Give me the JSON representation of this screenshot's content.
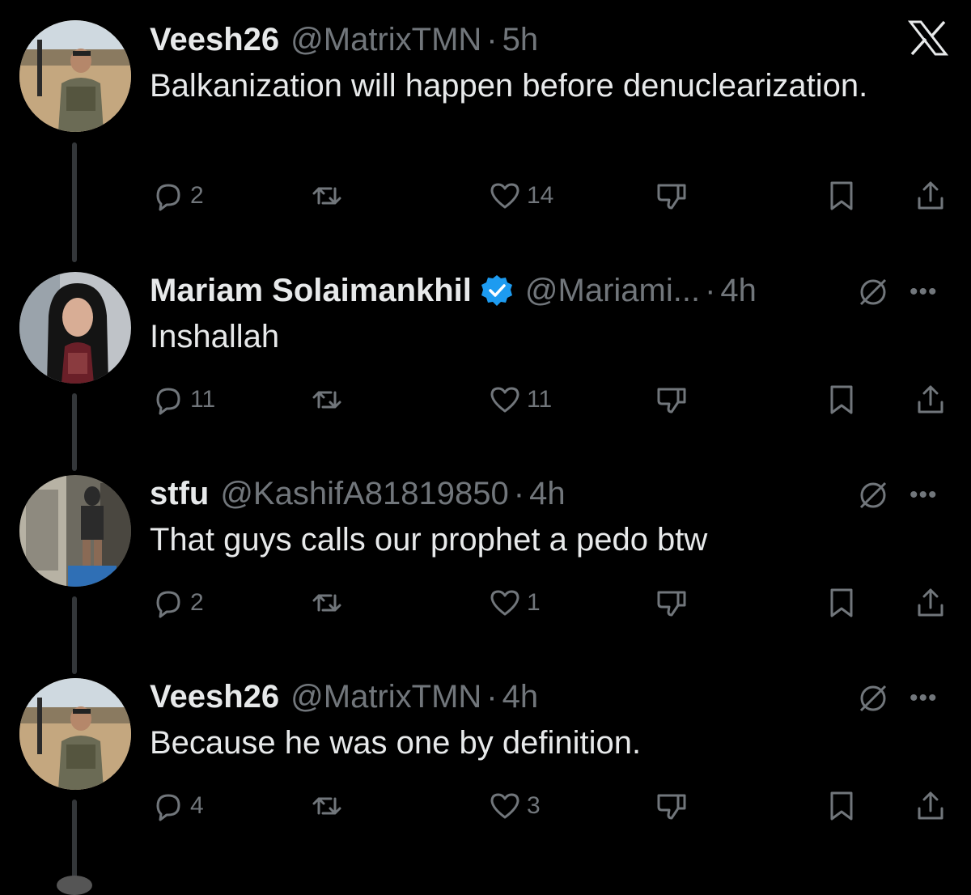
{
  "tweets": [
    {
      "name": "Veesh26",
      "handle": "@MatrixTMN",
      "dot": "·",
      "time": "5h",
      "text": "Balkanization will happen before denuclearization.",
      "replies": "2",
      "likes": "14"
    },
    {
      "name": "Mariam Solaimankhil",
      "handle": "@Mariami...",
      "dot": "·",
      "time": "4h",
      "text": "Inshallah",
      "replies": "11",
      "likes": "11"
    },
    {
      "name": "stfu",
      "handle": "@KashifA81819850",
      "dot": "·",
      "time": "4h",
      "text": "That guys calls our prophet a pedo btw",
      "replies": "2",
      "likes": "1"
    },
    {
      "name": "Veesh26",
      "handle": "@MatrixTMN",
      "dot": "·",
      "time": "4h",
      "text": "Because he was one by definition.",
      "replies": "4",
      "likes": "3"
    }
  ],
  "icons": {
    "reply": "reply-icon",
    "retweet": "retweet-icon",
    "like": "like-icon",
    "dislike": "dislike-icon",
    "bookmark": "bookmark-icon",
    "share": "share-icon",
    "mute": "mute-icon",
    "more": "more-icon",
    "close": "x-logo-icon",
    "verified": "verified-badge-icon"
  },
  "more_glyph": "•••",
  "colors": {
    "background": "#000000",
    "text": "#e7e9ea",
    "muted": "#71767b",
    "verified": "#1d9bf0",
    "thread_line": "#333639"
  }
}
